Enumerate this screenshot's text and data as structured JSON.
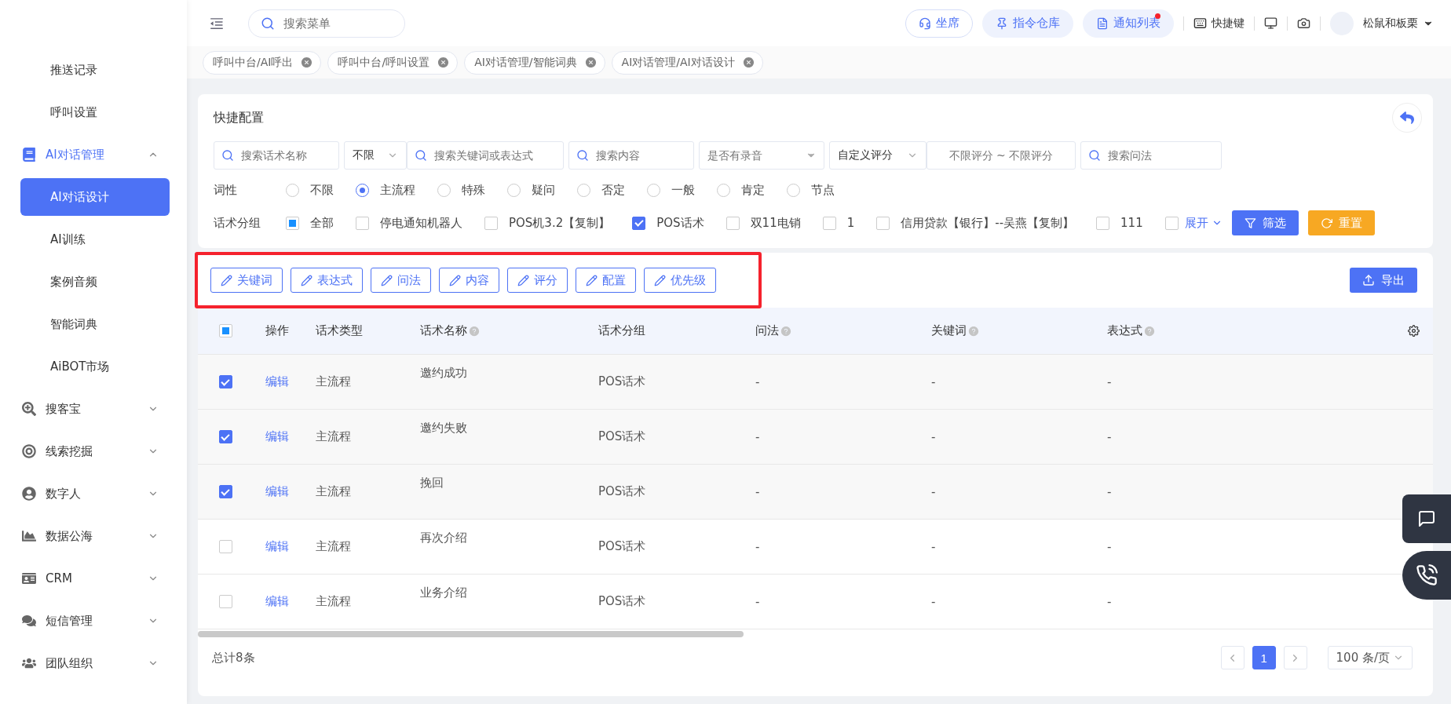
{
  "header": {
    "search": {
      "placeholder": "搜索菜单"
    },
    "actions": [
      {
        "label": "坐席",
        "kind": "outline",
        "badge": false
      },
      {
        "label": "指令仓库",
        "kind": "soft",
        "badge": false
      },
      {
        "label": "通知列表",
        "kind": "soft",
        "badge": true
      }
    ],
    "shortcut": "快捷键",
    "user": "松鼠和板栗"
  },
  "sidebar": {
    "items": [
      {
        "label": "推送记录",
        "kind": "sub",
        "selected": false
      },
      {
        "label": "呼叫设置",
        "kind": "sub",
        "selected": false
      },
      {
        "label": "AI对话管理",
        "kind": "group",
        "expanded": true,
        "children": [
          {
            "label": "AI对话设计",
            "selected": true
          },
          {
            "label": "AI训练",
            "selected": false
          },
          {
            "label": "案例音频",
            "selected": false
          },
          {
            "label": "智能词典",
            "selected": false
          },
          {
            "label": "AiBOT市场",
            "selected": false
          }
        ]
      },
      {
        "label": "搜客宝",
        "kind": "group",
        "expanded": false
      },
      {
        "label": "线索挖掘",
        "kind": "group",
        "expanded": false
      },
      {
        "label": "数字人",
        "kind": "group",
        "expanded": false
      },
      {
        "label": "数据公海",
        "kind": "group",
        "expanded": false
      },
      {
        "label": "CRM",
        "kind": "group",
        "expanded": false
      },
      {
        "label": "短信管理",
        "kind": "group",
        "expanded": false
      },
      {
        "label": "团队组织",
        "kind": "group",
        "expanded": false
      }
    ]
  },
  "open_tabs": [
    "呼叫中台/AI呼出",
    "呼叫中台/呼叫设置",
    "AI对话管理/智能词典",
    "AI对话管理/AI对话设计"
  ],
  "filter": {
    "title": "快捷配置",
    "fields": [
      {
        "kind": "search",
        "placeholder": "搜索话术名称"
      },
      {
        "kind": "select-search",
        "value": "不限",
        "placeholder": "搜索关键词或表达式"
      },
      {
        "kind": "search",
        "placeholder": "搜索内容"
      },
      {
        "kind": "select",
        "placeholder": "是否有录音"
      },
      {
        "kind": "select-range",
        "value": "自定义评分",
        "placeholder": "不限评分 ~ 不限评分"
      },
      {
        "kind": "search",
        "placeholder": "搜索问法"
      }
    ],
    "part_of_speech": {
      "label": "词性",
      "options": [
        {
          "label": "不限",
          "selected": false
        },
        {
          "label": "主流程",
          "selected": true
        },
        {
          "label": "特殊",
          "selected": false
        },
        {
          "label": "疑问",
          "selected": false
        },
        {
          "label": "否定",
          "selected": false
        },
        {
          "label": "一般",
          "selected": false
        },
        {
          "label": "肯定",
          "selected": false
        },
        {
          "label": "节点",
          "selected": false
        }
      ]
    },
    "groups": {
      "label": "话术分组",
      "options": [
        {
          "label": "全部",
          "checked": false,
          "partial": true
        },
        {
          "label": "停电通知机器人",
          "checked": false,
          "partial": false
        },
        {
          "label": "POS机3.2【复制】",
          "checked": false,
          "partial": false
        },
        {
          "label": "POS话术",
          "checked": true,
          "partial": false
        },
        {
          "label": "双11电销",
          "checked": false,
          "partial": false
        },
        {
          "label": "1",
          "checked": false,
          "partial": false
        },
        {
          "label": "信用贷款【银行】--吴燕【复制】",
          "checked": false,
          "partial": false
        },
        {
          "label": "111",
          "checked": false,
          "partial": false
        },
        {
          "checked": false
        }
      ],
      "expand": "展开",
      "filter_button": "筛选",
      "reset_button": "重置"
    }
  },
  "toolbar": {
    "edit_buttons": [
      "关键词",
      "表达式",
      "问法",
      "内容",
      "评分",
      "配置",
      "优先级"
    ],
    "highlighted": true,
    "export_button": "导出"
  },
  "table": {
    "select_all": {
      "checked": false,
      "partial": true
    },
    "columns": [
      {
        "label": "操作",
        "help": false
      },
      {
        "label": "话术类型",
        "help": false
      },
      {
        "label": "话术名称",
        "help": true
      },
      {
        "label": "话术分组",
        "help": false
      },
      {
        "label": "问法",
        "help": true
      },
      {
        "label": "关键词",
        "help": true
      },
      {
        "label": "表达式",
        "help": true
      }
    ],
    "rows": [
      {
        "checked": true,
        "cells": [
          "编辑",
          "主流程",
          "邀约成功",
          "POS话术",
          "-",
          "-",
          "-"
        ]
      },
      {
        "checked": true,
        "cells": [
          "编辑",
          "主流程",
          "邀约失败",
          "POS话术",
          "-",
          "-",
          "-"
        ]
      },
      {
        "checked": true,
        "cells": [
          "编辑",
          "主流程",
          "挽回",
          "POS话术",
          "-",
          "-",
          "-"
        ]
      },
      {
        "checked": false,
        "cells": [
          "编辑",
          "主流程",
          "再次介绍",
          "POS话术",
          "-",
          "-",
          "-"
        ]
      },
      {
        "checked": false,
        "cells": [
          "编辑",
          "主流程",
          "业务介绍",
          "POS话术",
          "-",
          "-",
          "-"
        ]
      }
    ]
  },
  "footer": {
    "total": "总计8条",
    "pages": [
      {
        "label": "1",
        "selected": true
      }
    ],
    "page_size": "100 条/页"
  }
}
